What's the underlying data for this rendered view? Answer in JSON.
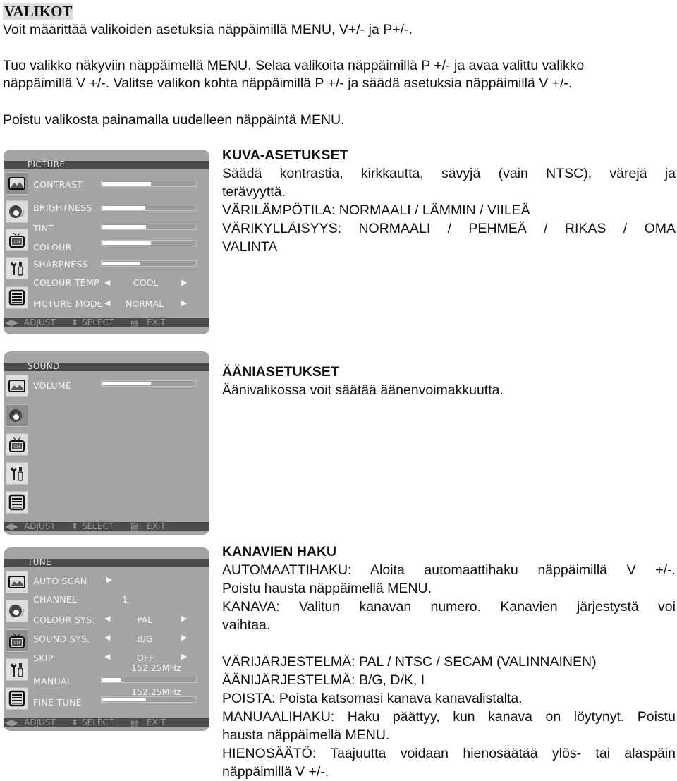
{
  "section_title": "VALIKOT",
  "intro": [
    "Voit määrittää valikoiden asetuksia näppäimillä MENU, V+/- ja P+/-.",
    "Tuo valikko näkyviin näppäimellä MENU. Selaa valikoita näppäimillä P +/- ja avaa valittu valikko",
    "näppäimillä V +/-. Valitse valikon kohta näppäimillä P +/- ja säädä asetuksia näppäimillä V +/-.",
    "Poistu valikosta painamalla uudelleen näppäintä MENU."
  ],
  "footer_labels": {
    "adjust": "ADJUST",
    "select": "SELECT",
    "exit": "EXIT"
  },
  "icons": [
    "picture-icon",
    "sound-icon",
    "channel-tv-icon",
    "tools-icon",
    "menu-list-icon"
  ],
  "picture_menu": {
    "title": "PICTURE",
    "selected_icon": 0,
    "items": [
      {
        "label": "CONTRAST",
        "type": "slider",
        "value_percent": 53
      },
      {
        "label": "BRIGHTNESS",
        "type": "slider",
        "value_percent": 47
      },
      {
        "label": "TINT",
        "type": "slider",
        "value_percent": 48
      },
      {
        "label": "COLOUR",
        "type": "slider",
        "value_percent": 53
      },
      {
        "label": "SHARPNESS",
        "type": "slider",
        "value_percent": 42
      },
      {
        "label": "COLOUR TEMP",
        "type": "select",
        "value": "COOL"
      },
      {
        "label": "PICTURE MODE",
        "type": "select",
        "value": "NORMAL"
      }
    ],
    "description": {
      "title": "KUVA-ASETUKSET",
      "lines": [
        "Säädä kontrastia, kirkkautta, sävyjä (vain NTSC), värejä ja",
        "terävyyttä.",
        "VÄRILÄMPÖTILA: NORMAALI / LÄMMIN / VIILEÄ",
        "VÄRIKYLLÄISYYS: NORMAALI / PEHMEÄ / RIKAS / OMA",
        "VALINTA"
      ]
    }
  },
  "sound_menu": {
    "title": "SOUND",
    "selected_icon": 1,
    "items": [
      {
        "label": "VOLUME",
        "type": "slider",
        "value_percent": 53
      }
    ],
    "description": {
      "title": "ÄÄNIASETUKSET",
      "lines": [
        "Äänivalikossa voit säätää äänenvoimakkuutta."
      ]
    }
  },
  "tune_menu": {
    "title": "TUNE",
    "selected_icon": 2,
    "items": [
      {
        "label": "AUTO SCAN",
        "type": "action"
      },
      {
        "label": "CHANNEL",
        "type": "value",
        "value": "1"
      },
      {
        "label": "COLOUR SYS.",
        "type": "select",
        "value": "PAL"
      },
      {
        "label": "SOUND SYS.",
        "type": "select",
        "value": "B/G"
      },
      {
        "label": "SKIP",
        "type": "select",
        "value": "OFF"
      },
      {
        "label": "MANUAL",
        "type": "slider",
        "value_percent": 22,
        "freq": "152.25MHz"
      },
      {
        "label": "FINE TUNE",
        "type": "slider",
        "value_percent": 48,
        "freq": "152.25MHz"
      }
    ],
    "description": {
      "title": "KANAVIEN HAKU",
      "lines": [
        "AUTOMAATTIHAKU: Aloita automaattihaku näppäimillä V +/-.",
        "Poistu hausta näppäimellä MENU.",
        "KANAVA: Valitun kanavan numero. Kanavien järjestystä voi",
        "vaihtaa.",
        "",
        "VÄRIJÄRJESTELMÄ: PAL / NTSC / SECAM (VALINNAINEN)",
        "ÄÄNIJÄRJESTELMÄ: B/G, D/K, I",
        "POISTA: Poista katsomasi kanava kanavalistalta.",
        "MANUAALIHAKU: Haku päättyy, kun kanava on löytynyt. Poistu",
        "hausta näppäimellä MENU.",
        "HIENOSÄÄTÖ: Taajuutta voidaan hienosäätää ylös- tai alaspäin",
        "näppäimillä V +/-."
      ]
    }
  }
}
